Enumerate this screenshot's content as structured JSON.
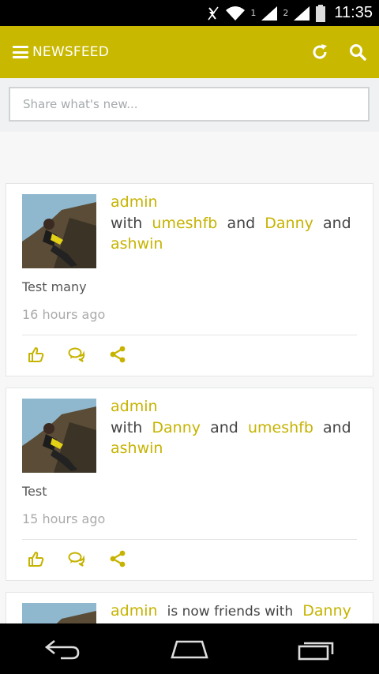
{
  "status_bar": {
    "time": "11:35",
    "sim1": "1",
    "sim2": "2"
  },
  "app_bar": {
    "title": "NEWSFEED",
    "icons": [
      "menu-icon",
      "refresh-icon",
      "search-icon"
    ]
  },
  "composer": {
    "placeholder": "Share what's new..."
  },
  "posts": [
    {
      "author": "admin",
      "with_word": "with",
      "tagged": [
        "umeshfb",
        "Danny",
        "ashwin"
      ],
      "and_word": "and",
      "text": "Test many",
      "time": "16 hours ago"
    },
    {
      "author": "admin",
      "with_word": "with",
      "tagged": [
        "Danny",
        "umeshfb",
        "ashwin"
      ],
      "and_word": "and",
      "text": "Test",
      "time": "15 hours ago"
    },
    {
      "author": "admin",
      "verb": "is now friends with",
      "friend": "Danny"
    }
  ],
  "post_actions": [
    "like-icon",
    "comment-icon",
    "share-icon"
  ],
  "colors": {
    "accent": "#c8b800",
    "link": "#c6b300",
    "status_bar": "#000000",
    "page_bg": "#f7f7f8"
  }
}
